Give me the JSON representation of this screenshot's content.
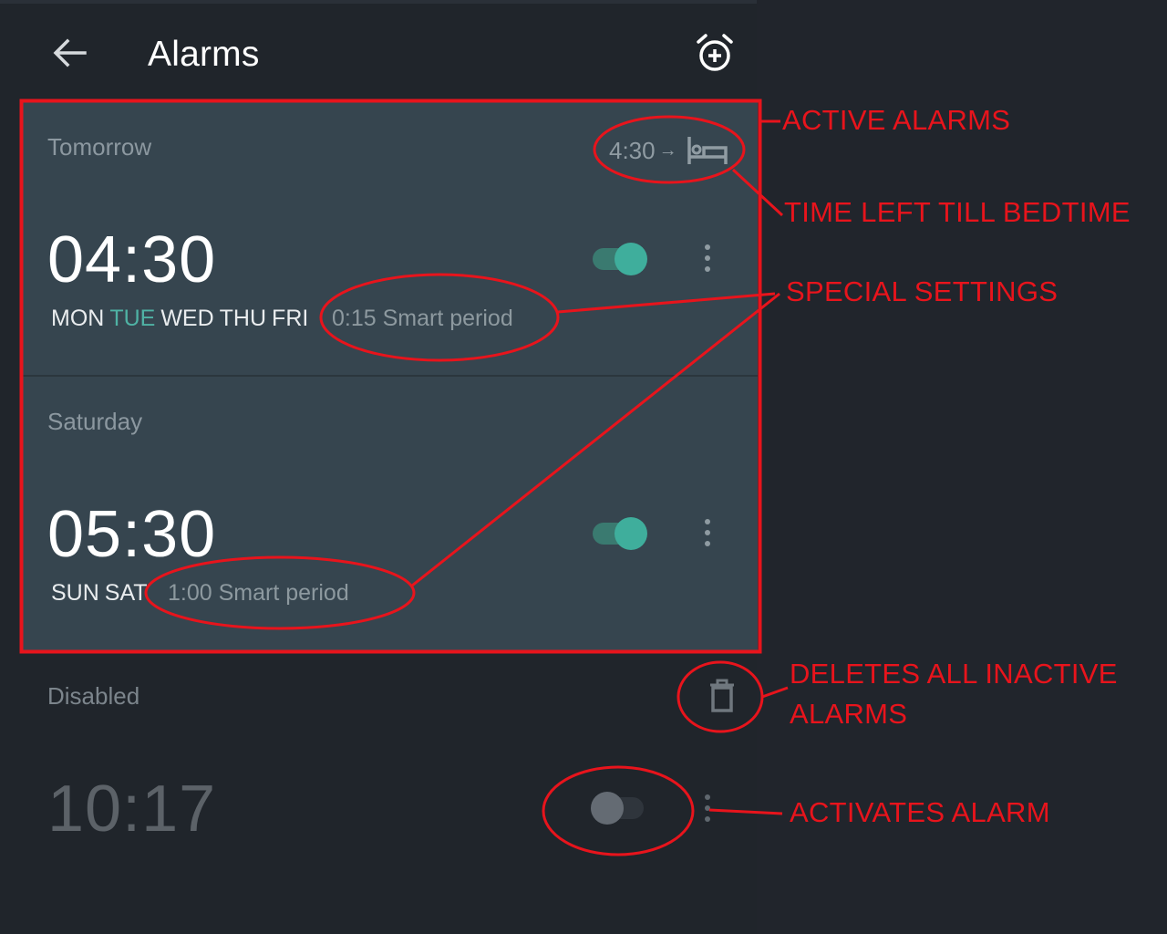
{
  "header": {
    "title": "Alarms",
    "back_icon": "arrow-left-icon",
    "add_icon": "alarm-add-icon"
  },
  "active_alarms": [
    {
      "day_label": "Tomorrow",
      "time": "04:30",
      "days": [
        {
          "label": "MON",
          "today": false
        },
        {
          "label": "TUE",
          "today": true
        },
        {
          "label": "WED",
          "today": false
        },
        {
          "label": "THU",
          "today": false
        },
        {
          "label": "FRI",
          "today": false
        }
      ],
      "smart_period": "0:15 Smart period",
      "enabled": true
    },
    {
      "day_label": "Saturday",
      "time": "05:30",
      "days": [
        {
          "label": "SUN",
          "today": false
        },
        {
          "label": "SAT",
          "today": false
        }
      ],
      "smart_period": "1:00 Smart period",
      "enabled": true
    }
  ],
  "bedtime": {
    "time": "4:30",
    "arrow": "→",
    "icon": "bed-icon"
  },
  "disabled_section": {
    "label": "Disabled",
    "delete_icon": "trash-icon",
    "alarm": {
      "time": "10:17",
      "enabled": false
    }
  },
  "annotations": {
    "active_alarms": "ACTIVE ALARMS",
    "time_left": "TIME LEFT TILL BEDTIME",
    "special_settings": "SPECIAL SETTINGS",
    "deletes_line1": "DELETES ALL INACTIVE",
    "deletes_line2": "ALARMS",
    "activates": "ACTIVATES ALARM"
  },
  "colors": {
    "background": "#20252b",
    "card": "#36454f",
    "accent": "#3fae9c",
    "today_day": "#4fb2a4",
    "annotation": "#e8141c"
  }
}
